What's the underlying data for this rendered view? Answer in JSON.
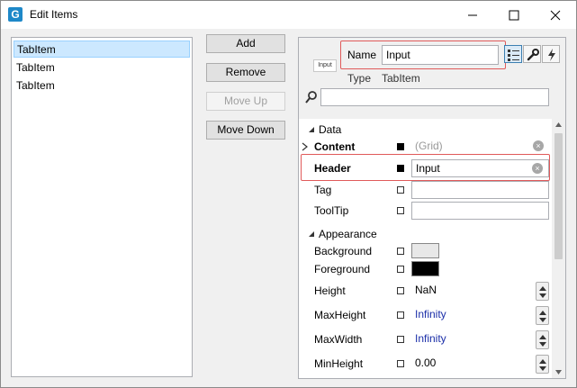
{
  "window": {
    "title": "Edit Items",
    "icon_letter": "G"
  },
  "list": {
    "items": [
      {
        "label": "TabItem",
        "selected": true
      },
      {
        "label": "TabItem",
        "selected": false
      },
      {
        "label": "TabItem",
        "selected": false
      }
    ]
  },
  "buttons": {
    "add": "Add",
    "remove": "Remove",
    "move_up": "Move Up",
    "move_down": "Move Down"
  },
  "properties": {
    "preview_text": "Input",
    "name_label": "Name",
    "name_value": "Input",
    "type_label": "Type",
    "type_value": "TabItem",
    "search_placeholder": "",
    "sections": {
      "data": "Data",
      "appearance": "Appearance"
    },
    "data_rows": [
      {
        "label": "Content",
        "value": "(Grid)"
      },
      {
        "label": "Header",
        "value": "Input"
      },
      {
        "label": "Tag",
        "value": ""
      },
      {
        "label": "ToolTip",
        "value": ""
      }
    ],
    "appearance_rows": [
      {
        "label": "Background",
        "color": "#e8e8e8"
      },
      {
        "label": "Foreground",
        "color": "#000000"
      },
      {
        "label": "Height",
        "value": "NaN"
      },
      {
        "label": "MaxHeight",
        "value": "Infinity"
      },
      {
        "label": "MaxWidth",
        "value": "Infinity"
      },
      {
        "label": "MinHeight",
        "value": "0.00"
      }
    ]
  },
  "colors": {
    "highlight": "#e05a5a",
    "selection": "#cce8ff",
    "accent": "#1e88c8"
  }
}
